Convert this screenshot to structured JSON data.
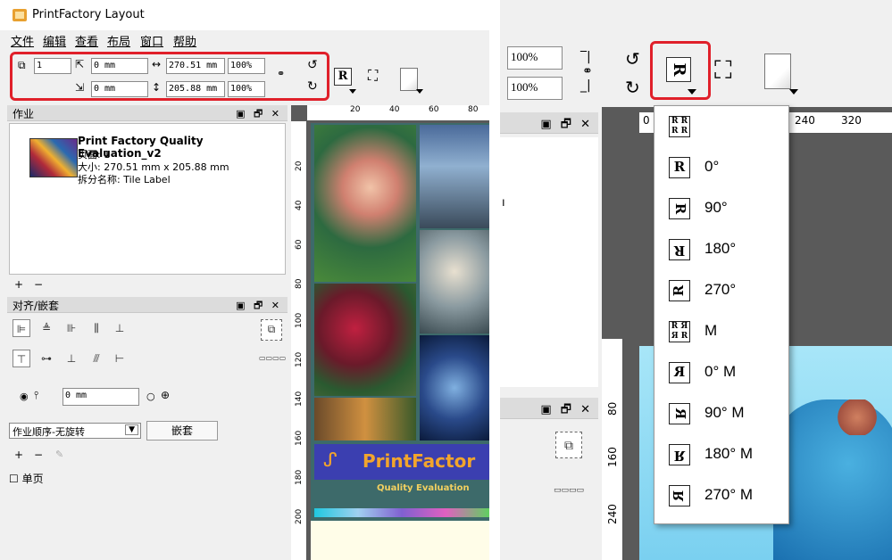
{
  "app": {
    "title": "PrintFactory Layout"
  },
  "menu": [
    "文件",
    "编辑",
    "查看",
    "布局",
    "窗口",
    "帮助"
  ],
  "toolbar": {
    "copies": "1",
    "offset_x": "0 mm",
    "offset_y": "0 mm",
    "width": "270.51 mm",
    "height": "205.88 mm",
    "scale_w": "100%",
    "scale_h": "100%",
    "rotation_icon": "R",
    "fit_icon": "fit-to-page-icon"
  },
  "job_panel": {
    "header": "作业",
    "job_name": "Print Factory Quality Evaluation_v2",
    "pages": "页面: 1",
    "size": "大小: 270.51 mm x 205.88 mm",
    "split_name": "拆分名称:  Tile Label",
    "add": "+",
    "remove": "−"
  },
  "align_panel": {
    "header": "对齐/嵌套",
    "gap_value": "0 mm",
    "order_select": "作业顺序-无旋转",
    "nest_button": "嵌套",
    "single_page": "单页",
    "add": "+",
    "remove": "−"
  },
  "ruler_left": {
    "h": [
      "20",
      "40",
      "60",
      "80"
    ],
    "v": [
      "20",
      "40",
      "60",
      "80",
      "100",
      "120",
      "140",
      "160",
      "180",
      "200"
    ]
  },
  "ruler_right": {
    "h": [
      "0",
      "240",
      "320"
    ],
    "v": [
      "80",
      "160",
      "240"
    ]
  },
  "brand": {
    "name": "PrintFactor",
    "tagline": "Quality Evaluation"
  },
  "zoom": {
    "scale_w": "100%",
    "scale_h": "100%"
  },
  "rotation_menu": [
    {
      "icon": "RR",
      "label": ""
    },
    {
      "icon": "R",
      "label": "0°"
    },
    {
      "icon": "R",
      "label": "90°"
    },
    {
      "icon": "R",
      "label": "180°"
    },
    {
      "icon": "R",
      "label": "270°"
    },
    {
      "icon": "RR",
      "label": "M"
    },
    {
      "icon": "R",
      "label": "0° M"
    },
    {
      "icon": "R",
      "label": "90° M"
    },
    {
      "icon": "R",
      "label": "180° M"
    },
    {
      "icon": "R",
      "label": "270° M"
    }
  ],
  "colors": {
    "highlight": "#e0202a",
    "canvas": "#5a5a5a",
    "brand_orange": "#f2a52c",
    "brand_blue": "#3b3fb0"
  }
}
